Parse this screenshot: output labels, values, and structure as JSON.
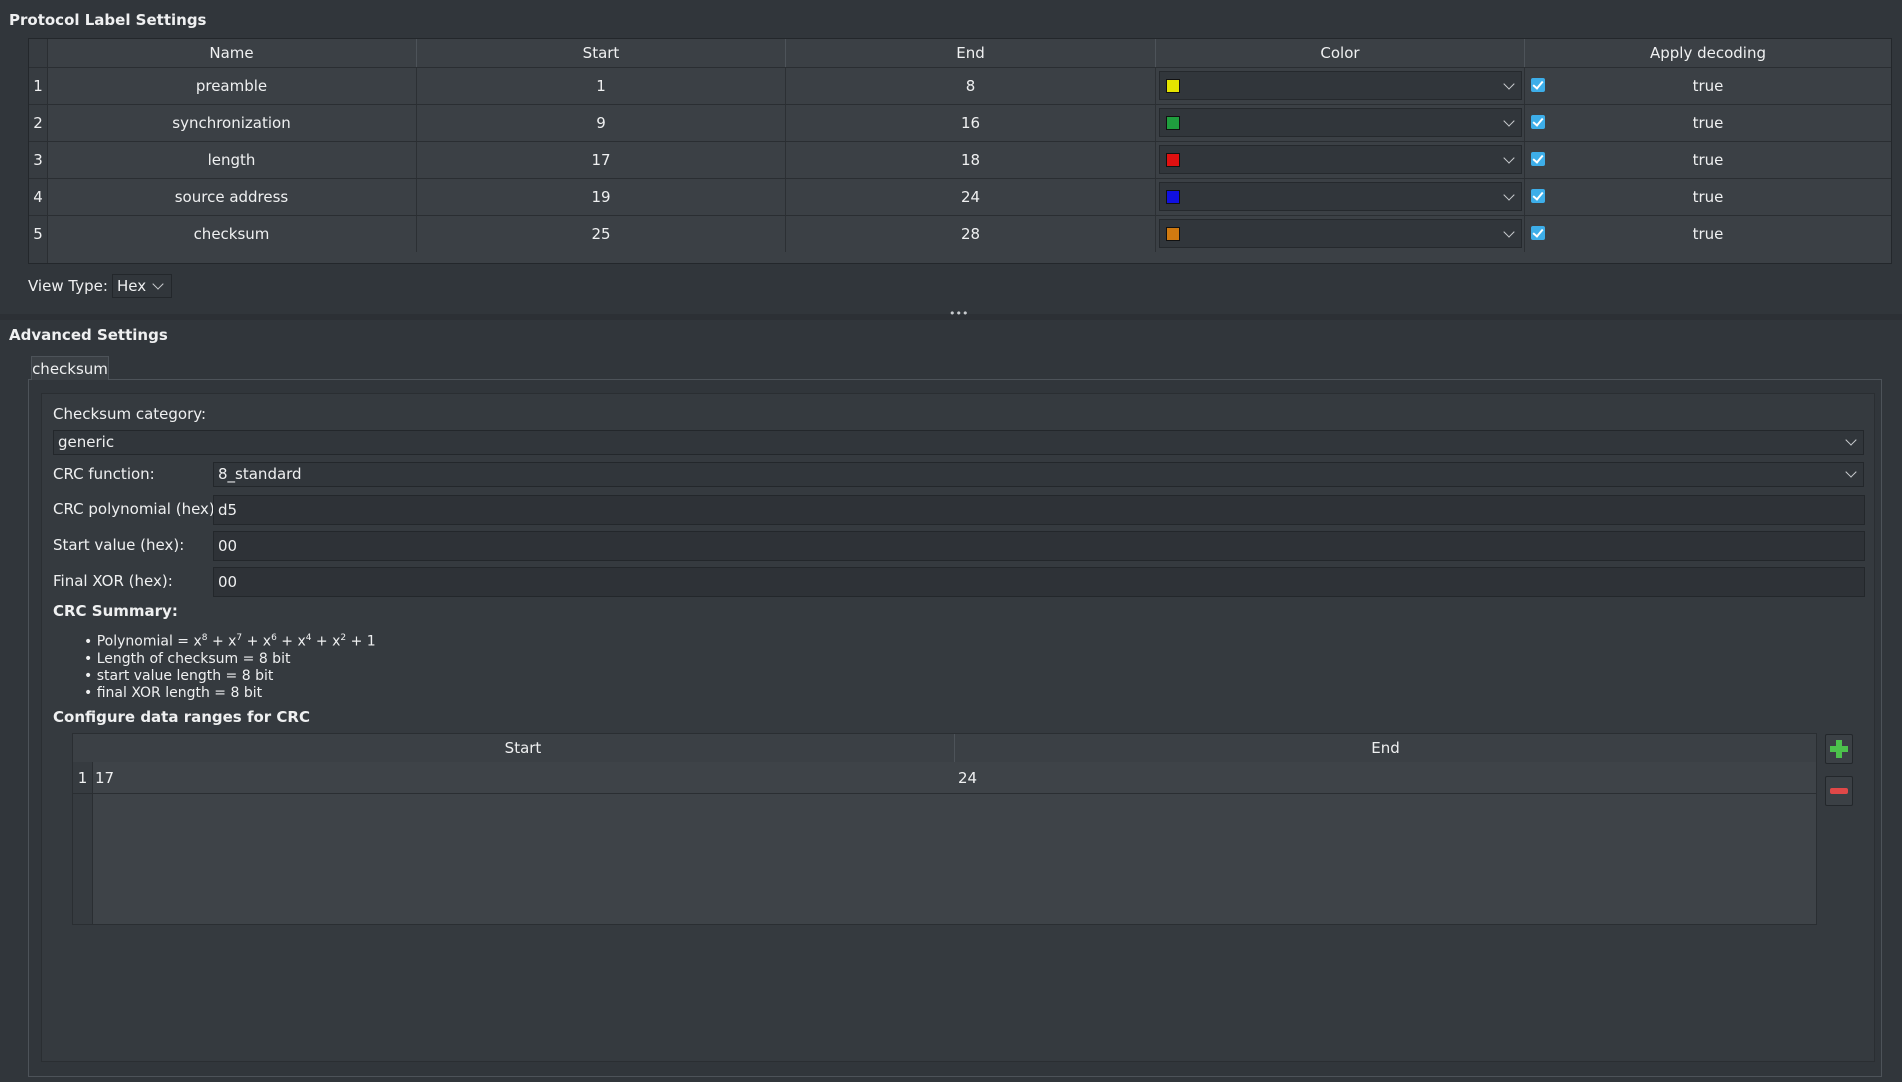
{
  "protocol_label_settings": {
    "title": "Protocol Label Settings",
    "headers": [
      "Name",
      "Start",
      "End",
      "Color",
      "Apply decoding"
    ],
    "rows": [
      {
        "num": "1",
        "name": "preamble",
        "start": "1",
        "end": "8",
        "color": "#e5e500",
        "apply": "true"
      },
      {
        "num": "2",
        "name": "synchronization",
        "start": "9",
        "end": "16",
        "color": "#1f9e3e",
        "apply": "true"
      },
      {
        "num": "3",
        "name": "length",
        "start": "17",
        "end": "18",
        "color": "#e01010",
        "apply": "true"
      },
      {
        "num": "4",
        "name": "source address",
        "start": "19",
        "end": "24",
        "color": "#1010e0",
        "apply": "true"
      },
      {
        "num": "5",
        "name": "checksum",
        "start": "25",
        "end": "28",
        "color": "#d07a10",
        "apply": "true"
      }
    ],
    "view_type_label": "View Type:",
    "view_type_value": "Hex"
  },
  "advanced_settings": {
    "title": "Advanced Settings",
    "tab_label": "checksum",
    "checksum_category_label": "Checksum category:",
    "checksum_category_value": "generic",
    "crc_function_label": "CRC function:",
    "crc_function_value": "8_standard",
    "crc_polynomial_label": "CRC polynomial (hex):",
    "crc_polynomial_value": "d5",
    "start_value_label": "Start value (hex):",
    "start_value_value": "00",
    "final_xor_label": "Final XOR (hex):",
    "final_xor_value": "00",
    "crc_summary_label": "CRC Summary:",
    "summary_items": [
      "Length of checksum = 8 bit",
      "start value length = 8 bit",
      "final XOR length = 8 bit"
    ],
    "polynomial_prefix": "Polynomial = ",
    "data_ranges_label": "Configure data ranges for CRC",
    "ranges_headers": [
      "Start",
      "End"
    ],
    "ranges_rows": [
      {
        "num": "1",
        "start": "17",
        "end": "24"
      }
    ]
  }
}
